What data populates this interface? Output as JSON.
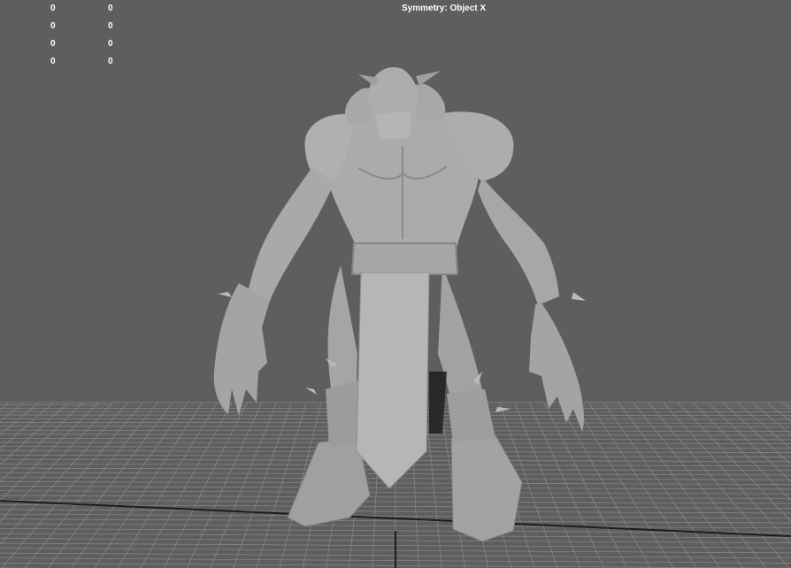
{
  "hud": {
    "symmetry_label": "Symmetry: Object X",
    "counter_rows": [
      {
        "col1": "0",
        "col2": "0"
      },
      {
        "col1": "0",
        "col2": "0"
      },
      {
        "col1": "0",
        "col2": "0"
      },
      {
        "col1": "0",
        "col2": "0"
      }
    ]
  },
  "colors": {
    "background": "#5e5e5e",
    "grid_line": "#8a8a8a",
    "grid_axis": "#1c1c1c",
    "model": "#a9a9a9",
    "model_shadow": "#7e7e7e",
    "model_highlight": "#c4c4c4",
    "hud_text": "#ffffff"
  },
  "icons": {
    "model": "character-model-icon"
  }
}
